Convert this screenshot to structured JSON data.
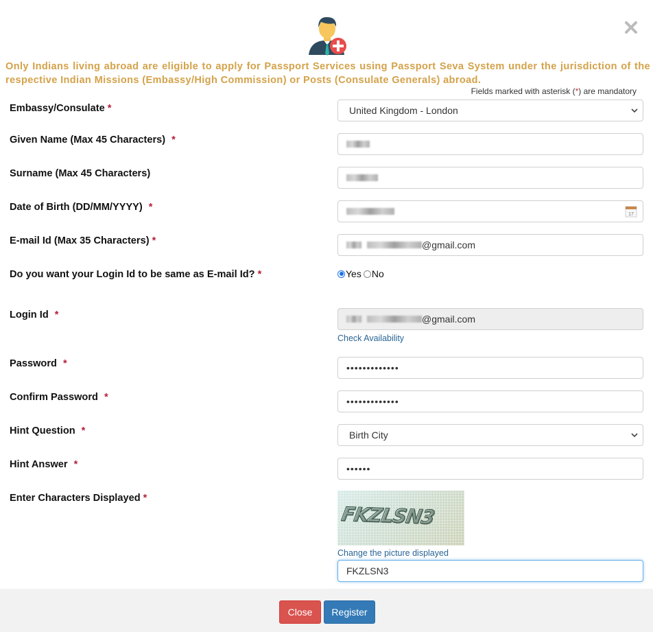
{
  "header": {
    "icon": "user-add-icon",
    "close_icon": "close-icon"
  },
  "notice": "Only Indians living abroad are eligible to apply for Passport Services using Passport Seva System under the jurisdiction of the respective Indian Missions (Embassy/High Commission) or Posts (Consulate Generals) abroad.",
  "mandatory_note": {
    "before": "Fields marked with asterisk (",
    "star": "*",
    "after": ") are mandatory"
  },
  "form": {
    "embassy": {
      "label": "Embassy/Consulate",
      "required": "*",
      "value": "United Kingdom - London"
    },
    "given_name": {
      "label": "Given Name (Max 45 Characters)",
      "required": "*"
    },
    "surname": {
      "label": "Surname (Max 45 Characters)"
    },
    "dob": {
      "label": "Date of Birth (DD/MM/YYYY)",
      "required": "*",
      "icon": "calendar-icon"
    },
    "email": {
      "label": "E-mail Id (Max 35 Characters)",
      "required": "*",
      "value_suffix": "@gmail.com"
    },
    "login_same": {
      "label": "Do you want your Login Id to be same as E-mail Id?",
      "required": "*",
      "options": [
        "Yes",
        "No"
      ],
      "selected": "Yes"
    },
    "login_id": {
      "label": "Login Id",
      "required": "*",
      "value_suffix": "@gmail.com",
      "link": "Check Availability"
    },
    "password": {
      "label": "Password",
      "required": "*",
      "value": "•••••••••••••"
    },
    "confirm_password": {
      "label": "Confirm Password",
      "required": "*",
      "value": "•••••••••••••"
    },
    "hint_question": {
      "label": "Hint Question",
      "required": "*",
      "value": "Birth City"
    },
    "hint_answer": {
      "label": "Hint Answer",
      "required": "*",
      "value": "••••••"
    },
    "captcha": {
      "label": "Enter Characters Displayed",
      "required": "*",
      "image_text": "FKZLSN3",
      "change_link": "Change the picture displayed",
      "value": "FKZLSN3"
    }
  },
  "footer": {
    "close_label": "Close",
    "register_label": "Register"
  },
  "colors": {
    "notice": "#d4a24a",
    "required": "#b5203a",
    "link": "#2a6496",
    "close_button": "#d9534f",
    "register_button": "#337ab7"
  }
}
